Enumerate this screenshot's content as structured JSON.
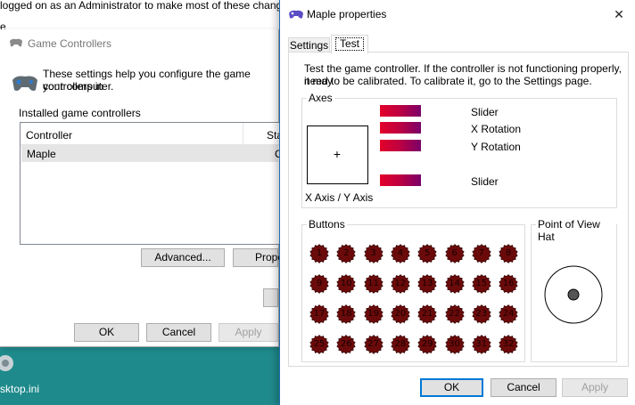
{
  "background": {
    "top_text": "logged on as an Administrator to make most of these changes.",
    "stub_e": "e",
    "stub_l": "l",
    "desktop_icon_label": "sktop.ini"
  },
  "game_controllers": {
    "title": "Game Controllers",
    "description": "These settings help you configure the game controllers installed on your computer.",
    "description_line1": "These settings help you configure the game controllers in",
    "description_line2": "your computer.",
    "installed_label": "Installed game controllers",
    "columns": [
      "Controller",
      "Sta"
    ],
    "rows": [
      {
        "controller": "Maple",
        "status": "O"
      }
    ],
    "advanced_button": "Advanced...",
    "properties_button": "Prope",
    "ok_button": "OK",
    "cancel_button": "Cancel",
    "apply_button": "Apply"
  },
  "props": {
    "title": "Maple properties",
    "close_glyph": "✕",
    "tabs": [
      "Settings",
      "Test"
    ],
    "active_tab": "Test",
    "intro_line1": "Test the game controller.  If the controller is not functioning properly, it may",
    "intro_line2": "need to be calibrated.  To calibrate it, go to the Settings page.",
    "axes_label": "Axes",
    "xy_label": "X Axis / Y Axis",
    "crosshair": "+",
    "axis_rows": [
      {
        "label": "Slider",
        "level": 1.0
      },
      {
        "label": "X Rotation",
        "level": 1.0
      },
      {
        "label": "Y Rotation",
        "level": 1.0
      },
      {
        "label": "Slider",
        "level": 1.0
      }
    ],
    "buttons_label": "Buttons",
    "button_numbers": [
      "1",
      "2",
      "3",
      "4",
      "5",
      "6",
      "7",
      "8",
      "9",
      "10",
      "11",
      "12",
      "13",
      "14",
      "15",
      "16",
      "17",
      "18",
      "19",
      "20",
      "21",
      "22",
      "23",
      "24",
      "25",
      "26",
      "27",
      "28",
      "29",
      "30",
      "31",
      "32"
    ],
    "pov_label": "Point of View Hat",
    "ok_button": "OK",
    "cancel_button": "Cancel",
    "apply_button": "Apply",
    "colors": {
      "bar_start": "#e3002a",
      "bar_end": "#7a0069",
      "button_fill": "#6b0a0a",
      "accent": "#0078d7"
    }
  }
}
